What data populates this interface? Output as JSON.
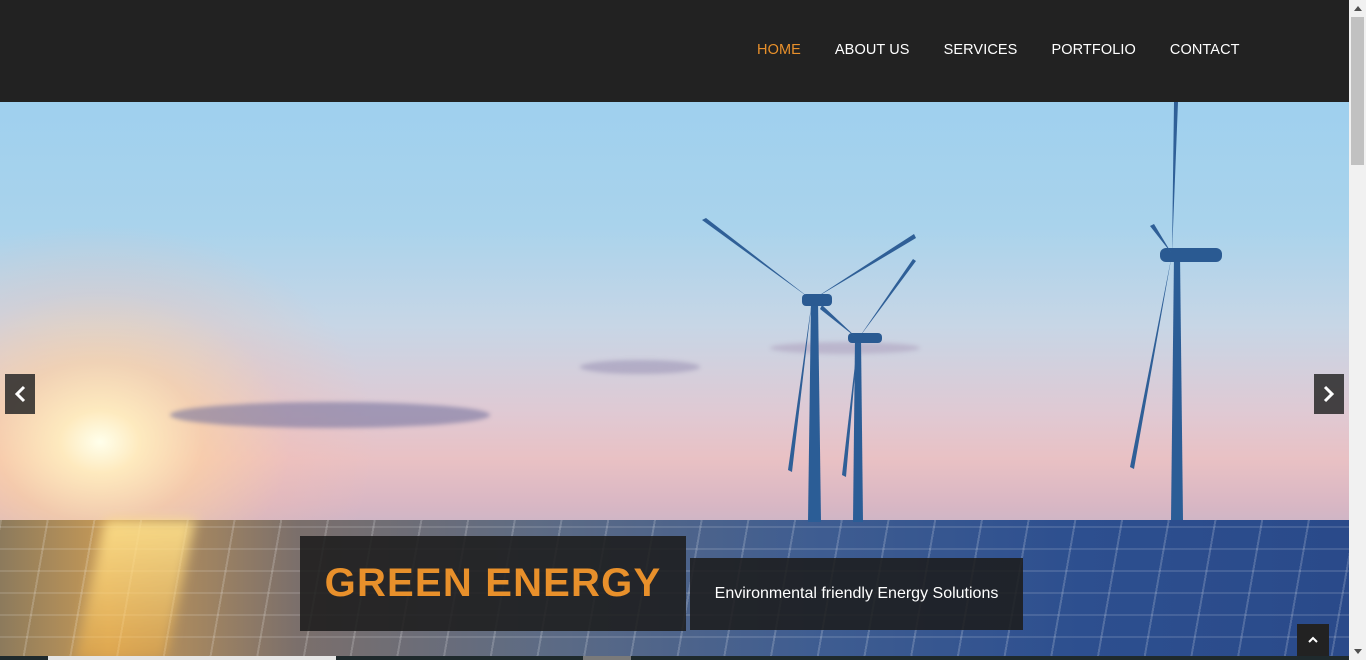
{
  "nav": {
    "items": [
      {
        "label": "HOME",
        "active": true
      },
      {
        "label": "ABOUT US",
        "active": false
      },
      {
        "label": "SERVICES",
        "active": false
      },
      {
        "label": "PORTFOLIO",
        "active": false
      },
      {
        "label": "CONTACT",
        "active": false
      }
    ]
  },
  "hero": {
    "title": "GREEN ENERGY",
    "subtitle": "Environmental friendly Energy Solutions"
  },
  "icons": {
    "prev": "chevron-left-icon",
    "next": "chevron-right-icon",
    "to_top": "chevron-up-icon"
  },
  "colors": {
    "accent": "#e8902b",
    "header_bg": "#222222"
  }
}
